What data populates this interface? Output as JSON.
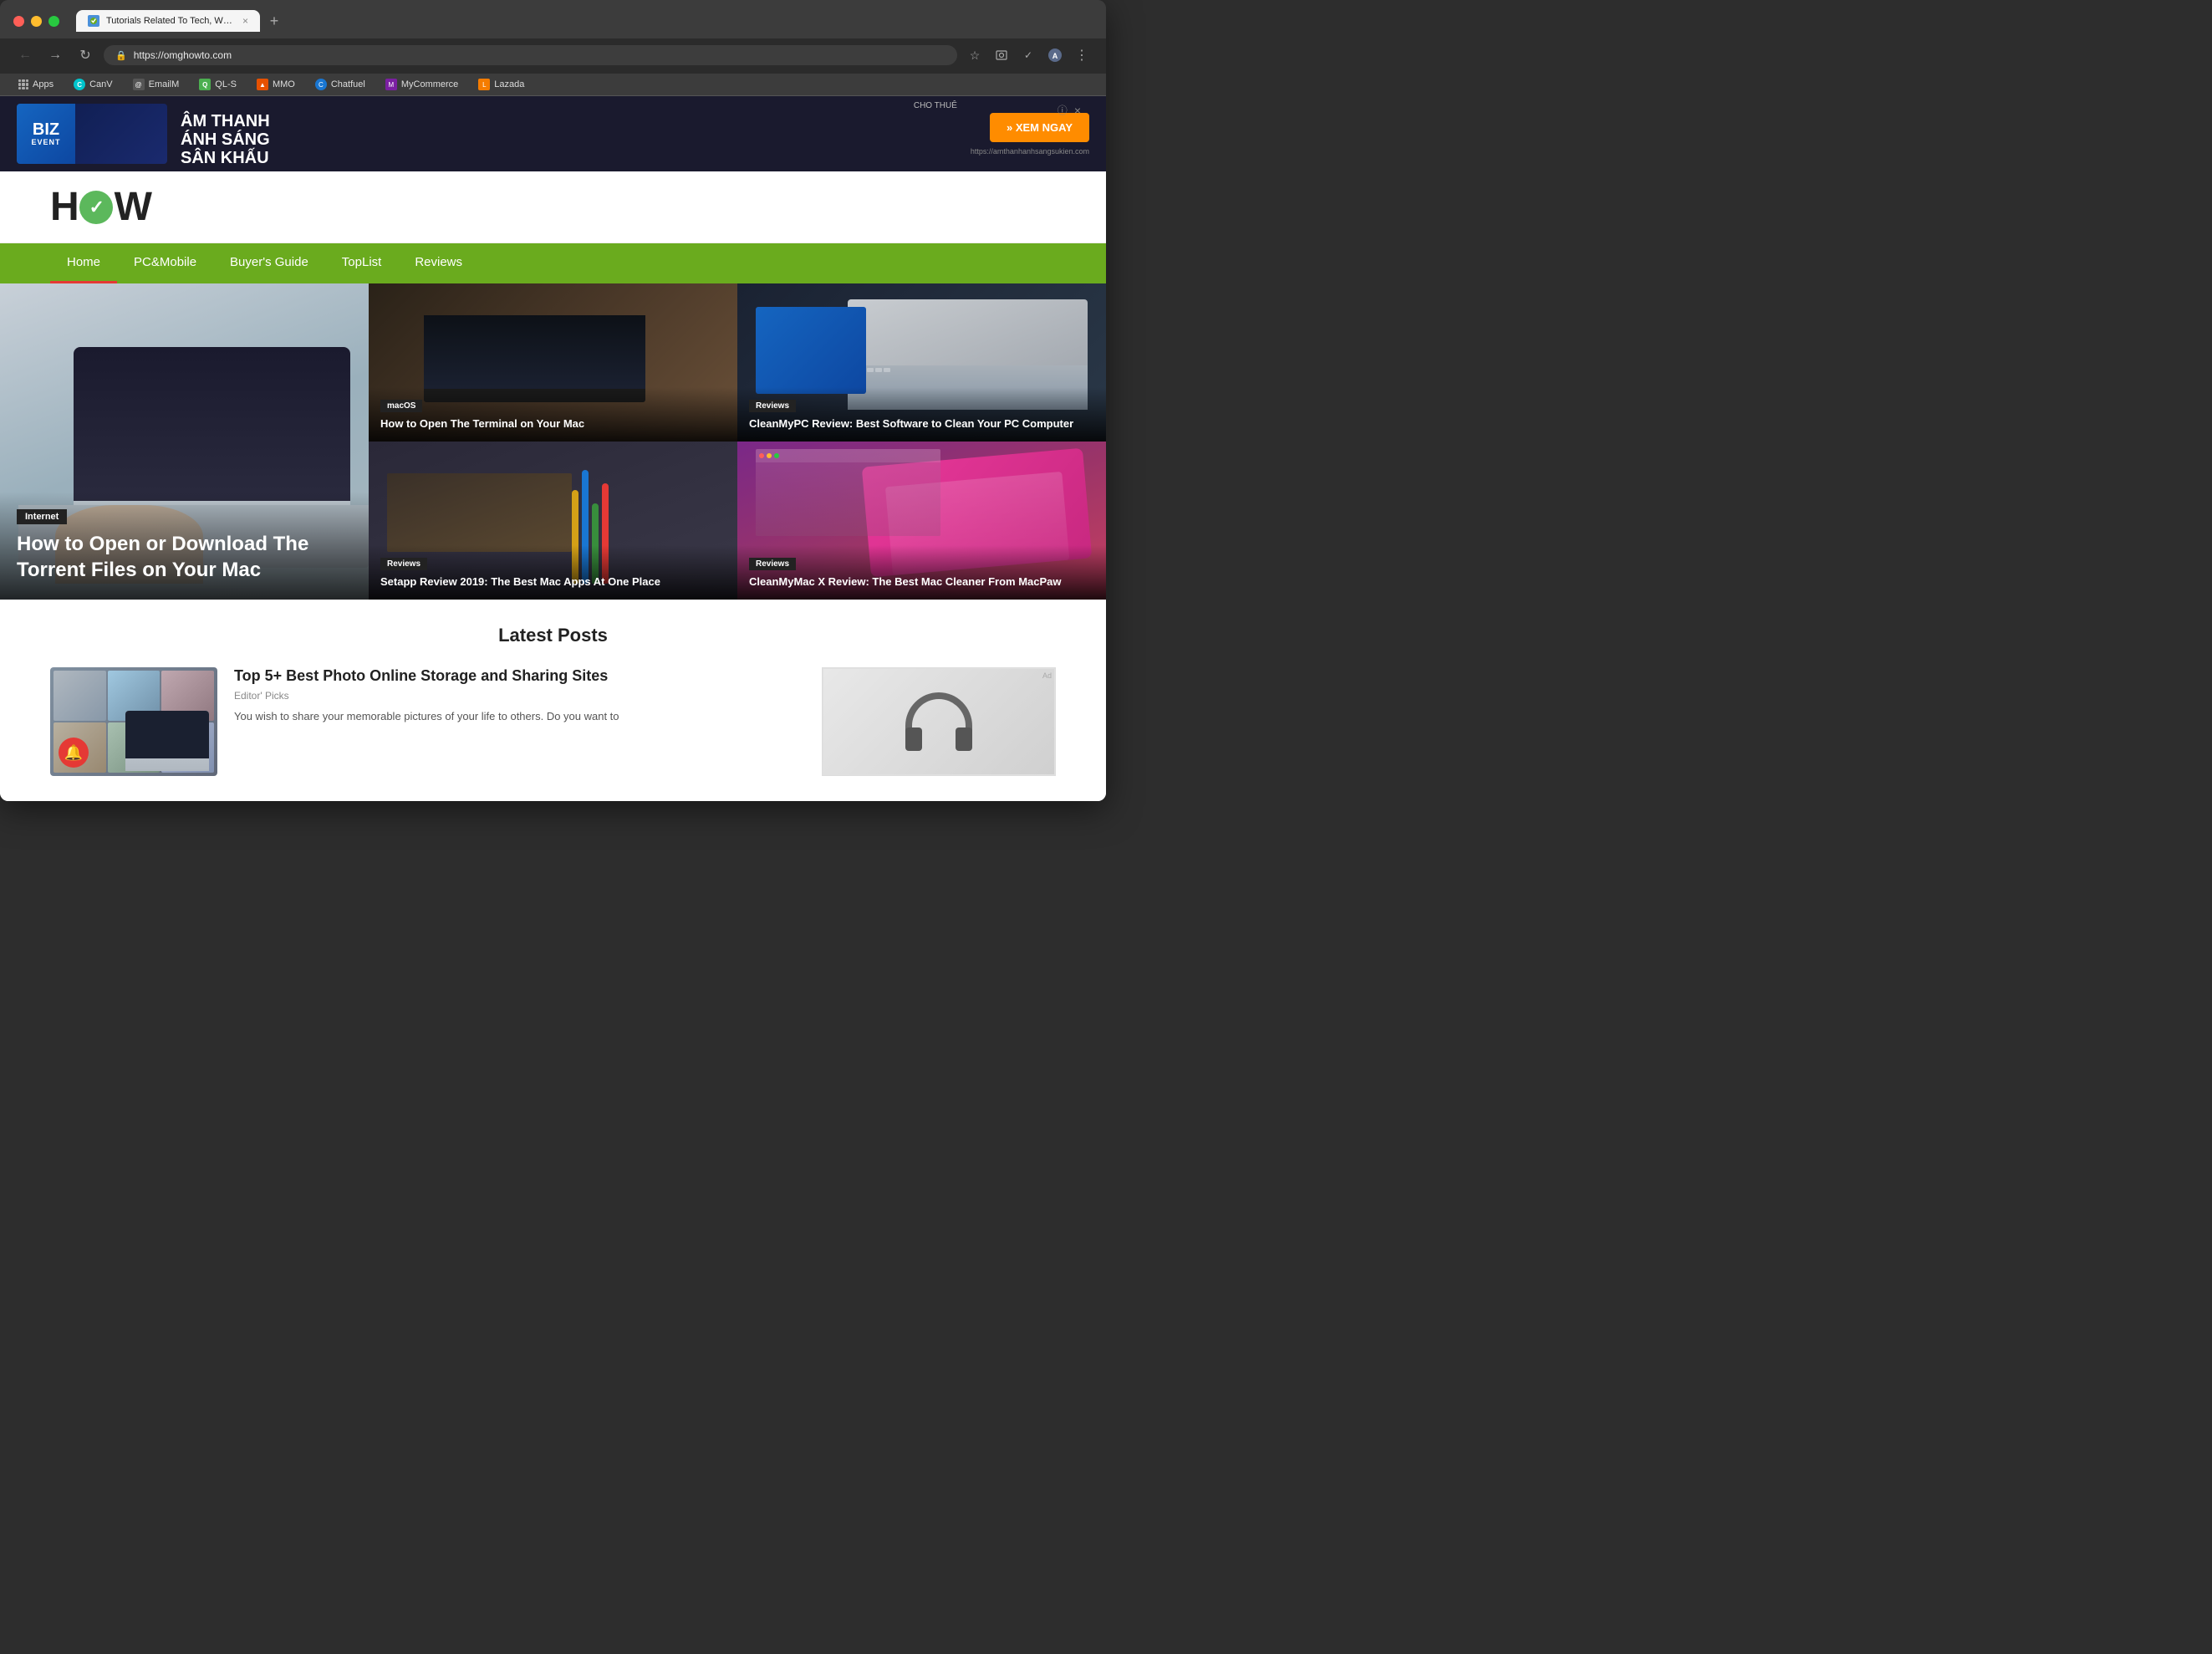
{
  "browser": {
    "tab": {
      "title": "Tutorials Related To Tech, Win...",
      "favicon_label": "omghowto-favicon",
      "close_label": "×"
    },
    "new_tab_label": "+",
    "url": "https://omghowto.com",
    "nav": {
      "back_label": "←",
      "forward_label": "→",
      "reload_label": "↻"
    },
    "omnibar_icons": {
      "star": "☆",
      "camera": "⊙",
      "check": "✓",
      "profile": "●",
      "menu": "⋮"
    },
    "bookmarks": [
      {
        "id": "apps",
        "label": "Apps",
        "icon_type": "grid"
      },
      {
        "id": "canva",
        "label": "CanV",
        "icon_color": "#00c4cc"
      },
      {
        "id": "emailm",
        "label": "EmailM",
        "icon_color": "#555"
      },
      {
        "id": "qls",
        "label": "QL-S",
        "icon_color": "#4caf50"
      },
      {
        "id": "mmo",
        "label": "MMO",
        "icon_color": "#e65100"
      },
      {
        "id": "chatfuel",
        "label": "Chatfuel",
        "icon_color": "#1976d2"
      },
      {
        "id": "mycommerce",
        "label": "MyCommerce",
        "icon_color": "#7b1fa2"
      },
      {
        "id": "lazada",
        "label": "Lazada",
        "icon_color": "#f57c00"
      }
    ]
  },
  "ad": {
    "info_label": "ⓘ",
    "close_label": "×",
    "visual_text": "BIZ",
    "sub_text": "EVENT",
    "cho_thue": "CHO THUÊ",
    "line1": "ÂM THANH",
    "line2": "ÁNH SÁNG",
    "line3": "SÂN KHẤU",
    "cta": "» XEM NGAY",
    "domain": "https://amthanhanhsangsukien.com"
  },
  "site": {
    "logo_h": "H",
    "logo_w": "W",
    "logo_checkmark": "✓"
  },
  "nav": {
    "items": [
      {
        "id": "home",
        "label": "Home",
        "active": true
      },
      {
        "id": "pc-mobile",
        "label": "PC&Mobile",
        "active": false
      },
      {
        "id": "buyers-guide",
        "label": "Buyer's Guide",
        "active": false
      },
      {
        "id": "toplist",
        "label": "TopList",
        "active": false
      },
      {
        "id": "reviews",
        "label": "Reviews",
        "active": false
      }
    ]
  },
  "hero": {
    "main": {
      "category": "Internet",
      "title": "How to Open or Download The Torrent Files on Your Mac"
    },
    "top_right": {
      "category": "macOS",
      "title": "How to Open The Terminal on Your Mac"
    },
    "mid_right_1": {
      "category": "Reviews",
      "title": "CleanMyPC Review: Best Software to Clean Your PC Computer"
    },
    "mid_right_2": {
      "category": "Reviews",
      "title": "Setapp Review 2019: The Best Mac Apps At One Place"
    },
    "bottom_right": {
      "category": "Reviews",
      "title": "CleanMyMac X Review: The Best Mac Cleaner From MacPaw"
    }
  },
  "latest_posts": {
    "section_title": "Latest Posts",
    "posts": [
      {
        "title": "Top 5+ Best Photo Online Storage and Sharing Sites",
        "tag": "Editor' Picks",
        "excerpt": "You wish to share your memorable pictures of your life to others. Do you want to"
      }
    ]
  }
}
